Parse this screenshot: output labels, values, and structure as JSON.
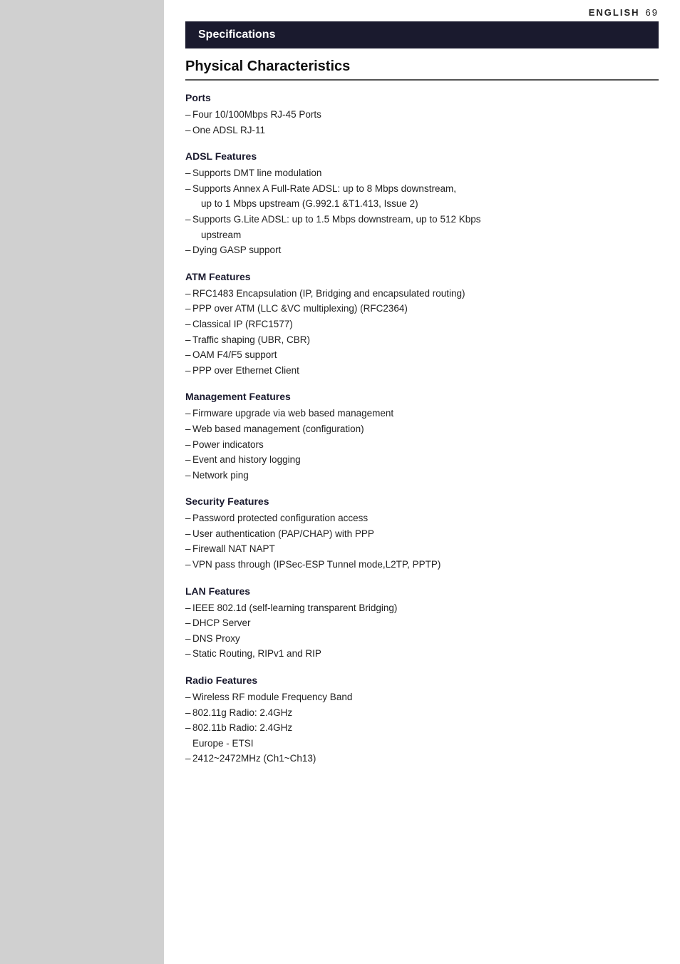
{
  "header": {
    "language": "ENGLISH",
    "page_number": "69"
  },
  "spec_bar": {
    "title": "Specifications"
  },
  "physical_characteristics": {
    "title": "Physical Characteristics",
    "ports": {
      "label": "Ports",
      "items": [
        "Four 10/100Mbps RJ-45 Ports",
        "One ADSL RJ-11"
      ]
    },
    "adsl_features": {
      "label": "ADSL Features",
      "items": [
        "Supports DMT line modulation",
        "Supports Annex A Full-Rate ADSL: up to 8 Mbps downstream,",
        "up to 1 Mbps upstream (G.992.1 &T1.413, Issue 2)",
        "Supports G.Lite ADSL: up to 1.5 Mbps downstream, up to 512 Kbps",
        "upstream",
        "Dying GASP support"
      ],
      "items_structured": [
        {
          "text": "Supports DMT line modulation",
          "indent": false
        },
        {
          "text": "Supports Annex A Full-Rate ADSL: up to 8 Mbps downstream,",
          "indent": false
        },
        {
          "text": "up to 1 Mbps upstream (G.992.1 &T1.413, Issue 2)",
          "indent": true
        },
        {
          "text": "Supports G.Lite ADSL: up to 1.5 Mbps downstream, up to 512 Kbps",
          "indent": false
        },
        {
          "text": "upstream",
          "indent": true
        },
        {
          "text": "Dying GASP support",
          "indent": false
        }
      ]
    },
    "atm_features": {
      "label": "ATM Features",
      "items": [
        "RFC1483 Encapsulation (IP, Bridging and encapsulated routing)",
        "PPP over ATM (LLC &VC multiplexing) (RFC2364)",
        "Classical IP (RFC1577)",
        "Traffic shaping (UBR, CBR)",
        "OAM F4/F5 support",
        "PPP over Ethernet Client"
      ]
    },
    "management_features": {
      "label": "Management Features",
      "items": [
        "Firmware upgrade via web based management",
        "Web based management (configuration)",
        "Power indicators",
        "Event and history logging",
        "Network ping"
      ]
    },
    "security_features": {
      "label": "Security Features",
      "items": [
        "Password protected configuration access",
        "User authentication (PAP/CHAP) with PPP",
        "Firewall NAT NAPT",
        "VPN pass through (IPSec-ESP Tunnel mode,L2TP, PPTP)"
      ]
    },
    "lan_features": {
      "label": "LAN Features",
      "items": [
        "IEEE 802.1d (self-learning transparent Bridging)",
        "DHCP Server",
        "DNS Proxy",
        "Static Routing, RIPv1 and RIP"
      ]
    },
    "radio_features": {
      "label": "Radio Features",
      "items": [
        "Wireless RF module Frequency Band",
        "802.11g Radio: 2.4GHz",
        "802.11b Radio: 2.4GHz",
        "Europe - ETSI",
        "2412~2472MHz (Ch1~Ch13)"
      ]
    }
  }
}
